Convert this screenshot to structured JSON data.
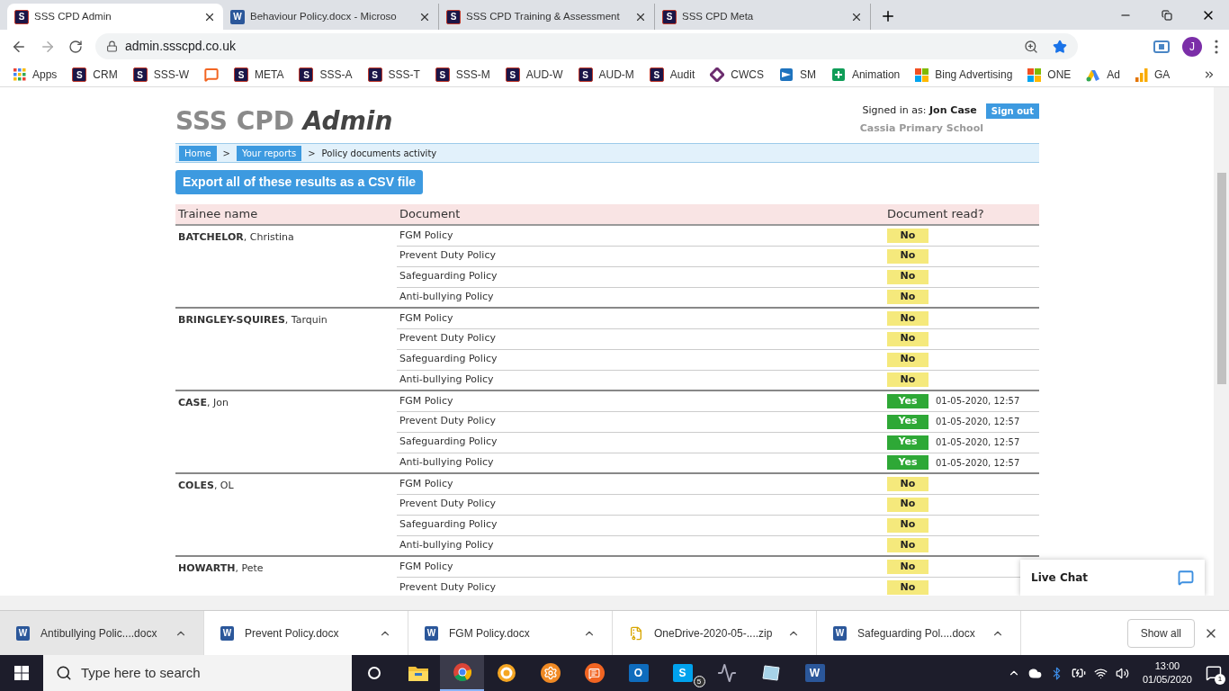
{
  "browser": {
    "tabs": [
      {
        "title": "SSS CPD Admin",
        "kind": "s",
        "badge": "S",
        "selected": true
      },
      {
        "title": "Behaviour Policy.docx - Microso",
        "kind": "word",
        "badge": "W",
        "selected": false
      },
      {
        "title": "SSS CPD Training & Assessment",
        "kind": "s",
        "badge": "S",
        "selected": false
      },
      {
        "title": "SSS CPD Meta",
        "kind": "s",
        "badge": "S",
        "selected": false
      }
    ],
    "address": "admin.ssscpd.co.uk",
    "profile": "J",
    "bookmarks": [
      {
        "label": "Apps",
        "kind": "apps"
      },
      {
        "label": "CRM",
        "kind": "s",
        "badge": "S"
      },
      {
        "label": "SSS-W",
        "kind": "s",
        "badge": "S"
      },
      {
        "kind": "chat"
      },
      {
        "label": "META",
        "kind": "s",
        "badge": "S"
      },
      {
        "label": "SSS-A",
        "kind": "s",
        "badge": "S"
      },
      {
        "label": "SSS-T",
        "kind": "s",
        "badge": "S"
      },
      {
        "label": "SSS-M",
        "kind": "s",
        "badge": "S"
      },
      {
        "label": "AUD-W",
        "kind": "s",
        "badge": "S"
      },
      {
        "label": "AUD-M",
        "kind": "s",
        "badge": "S"
      },
      {
        "label": "Audit",
        "kind": "s",
        "badge": "S"
      },
      {
        "label": "CWCS",
        "kind": "diamond"
      },
      {
        "label": "SM",
        "kind": "sm"
      },
      {
        "label": "Animation",
        "kind": "plus"
      },
      {
        "label": "Bing Advertising",
        "kind": "tiles"
      },
      {
        "label": "ONE",
        "kind": "tiles"
      },
      {
        "label": "Ad",
        "kind": "ads"
      },
      {
        "label": "GA",
        "kind": "bars"
      }
    ]
  },
  "page": {
    "title": "SSS CPD",
    "title_emphasis": "Admin",
    "signed_in": "Signed in as: **Jon Case**",
    "sign_out": "Sign out",
    "school": "Cassia Primary School",
    "breadcrumb": [
      {
        "label": "Home",
        "kind": "link"
      },
      {
        "label": ">",
        "kind": "separator"
      },
      {
        "label": "Your reports",
        "kind": "link"
      },
      {
        "label": ">",
        "kind": "separator"
      },
      {
        "label": "Policy documents activity",
        "kind": "current"
      }
    ],
    "export_button": "Export all of these results as a CSV file",
    "table": {
      "columns": [
        "Trainee name",
        "Document",
        "Document read?"
      ],
      "groups": [
        {
          "trainee": "**BATCHELOR**, Christina",
          "rows": [
            {
              "document": "FGM Policy",
              "status": "No",
              "read": false
            },
            {
              "document": "Prevent Duty Policy",
              "status": "No",
              "read": false
            },
            {
              "document": "Safeguarding Policy",
              "status": "No",
              "read": false
            },
            {
              "document": "Anti-bullying Policy",
              "status": "No",
              "read": false
            }
          ]
        },
        {
          "trainee": "**BRINGLEY-SQUIRES**, Tarquin",
          "rows": [
            {
              "document": "FGM Policy",
              "status": "No",
              "read": false
            },
            {
              "document": "Prevent Duty Policy",
              "status": "No",
              "read": false
            },
            {
              "document": "Safeguarding Policy",
              "status": "No",
              "read": false
            },
            {
              "document": "Anti-bullying Policy",
              "status": "No",
              "read": false
            }
          ]
        },
        {
          "trainee": "**CASE**, Jon",
          "rows": [
            {
              "document": "FGM Policy",
              "status": "Yes",
              "read": true,
              "date": "01-05-2020, 12:57"
            },
            {
              "document": "Prevent Duty Policy",
              "status": "Yes",
              "read": true,
              "date": "01-05-2020, 12:57"
            },
            {
              "document": "Safeguarding Policy",
              "status": "Yes",
              "read": true,
              "date": "01-05-2020, 12:57"
            },
            {
              "document": "Anti-bullying Policy",
              "status": "Yes",
              "read": true,
              "date": "01-05-2020, 12:57"
            }
          ]
        },
        {
          "trainee": "**COLES**, OL",
          "rows": [
            {
              "document": "FGM Policy",
              "status": "No",
              "read": false
            },
            {
              "document": "Prevent Duty Policy",
              "status": "No",
              "read": false
            },
            {
              "document": "Safeguarding Policy",
              "status": "No",
              "read": false
            },
            {
              "document": "Anti-bullying Policy",
              "status": "No",
              "read": false
            }
          ]
        },
        {
          "trainee": "**HOWARTH**, Pete",
          "rows": [
            {
              "document": "FGM Policy",
              "status": "No",
              "read": false
            },
            {
              "document": "Prevent Duty Policy",
              "status": "No",
              "read": false
            }
          ]
        }
      ]
    },
    "live_chat": "Live Chat"
  },
  "downloads": {
    "items": [
      {
        "name": "Antibullying Polic....docx",
        "kind": "word",
        "badge": "W",
        "selected": true
      },
      {
        "name": "Prevent Policy.docx",
        "kind": "word",
        "badge": "W",
        "selected": false
      },
      {
        "name": "FGM Policy.docx",
        "kind": "word",
        "badge": "W",
        "selected": false
      },
      {
        "name": "OneDrive-2020-05-....zip",
        "kind": "zip",
        "selected": false
      },
      {
        "name": "Safeguarding Pol....docx",
        "kind": "word",
        "badge": "W",
        "selected": false
      }
    ],
    "show_all": "Show all"
  },
  "taskbar": {
    "search_placeholder": "Type here to search",
    "apps": [
      {
        "kind": "cortana",
        "selected": false
      },
      {
        "kind": "explorer",
        "selected": false
      },
      {
        "kind": "chrome",
        "selected": true
      },
      {
        "kind": "orange-ring",
        "selected": false
      },
      {
        "kind": "gear",
        "selected": false
      },
      {
        "kind": "chat",
        "selected": false
      },
      {
        "kind": "letter",
        "badge": "O",
        "color": "#0f6cbd",
        "selected": false
      },
      {
        "kind": "letter",
        "badge": "S",
        "color": "#00a2ed",
        "count": "5",
        "selected": false
      },
      {
        "kind": "pulse",
        "selected": false
      },
      {
        "kind": "glass",
        "selected": false
      },
      {
        "kind": "letter",
        "badge": "W",
        "color": "#2b579a",
        "selected": false
      }
    ],
    "time": "13:00",
    "date": "01/05/2020",
    "notifications": "1"
  }
}
